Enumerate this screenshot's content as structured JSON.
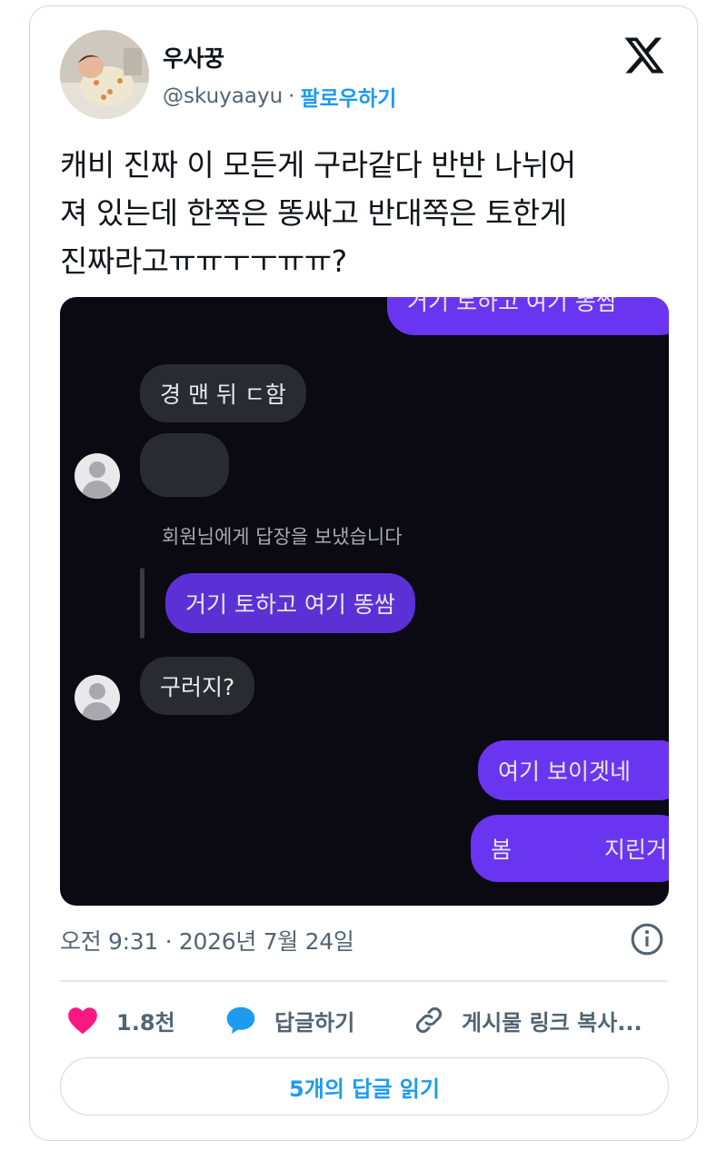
{
  "author": {
    "name": "우사꿍",
    "handle": "@skuyaayu",
    "separator": "·",
    "follow_label": "팔로우하기"
  },
  "tweet": {
    "text": "캐비 진짜 이 모든게 구라같다 반반 나뉘어\n져 있는데 한쪽은 똥싸고 반대쪽은 토한게\n진짜라고ㅠㅠㅜㅜㅠㅠ?"
  },
  "media": {
    "messages": {
      "top_cut": "거기 토하고 여기 똥쌈",
      "m1": "경 맨 뒤 ㄷ함",
      "system_note": "회원님에게 답장을 보냈습니다",
      "reply": "거기 토하고 여기 똥쌈",
      "m3": "구러지?",
      "m4": "여기 보이겟네",
      "m5a": "봄",
      "m5b": "지린거"
    }
  },
  "meta": {
    "timestamp": "오전 9:31 · 2026년 7월 24일"
  },
  "actions": {
    "likes": "1.8천",
    "reply_label": "답글하기",
    "copy_label": "게시물 링크 복사..."
  },
  "read_replies": "5개의 답글 읽기",
  "colors": {
    "accent": "#1d9bf0",
    "like": "#f91880",
    "dm_purple": "#6a35f0",
    "dm_background": "#0b0a13"
  },
  "icons": [
    "x-logo-icon",
    "info-icon",
    "heart-icon",
    "reply-bubble-icon",
    "link-icon"
  ]
}
